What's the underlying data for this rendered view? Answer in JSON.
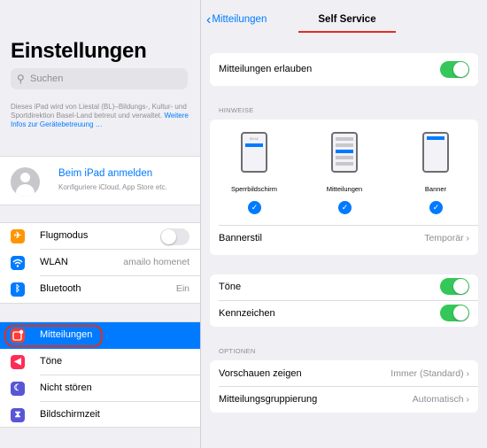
{
  "left": {
    "title": "Einstellungen",
    "search_placeholder": "Suchen",
    "notice_text": "Dieses iPad wird von Liestal (BL)–Bildungs-, Kultur- und Sportdirektion Basel-Land betreut und verwaltet.",
    "notice_link": "Weitere Infos zur Gerätebetreuung …",
    "account": {
      "name": "Beim iPad anmelden",
      "subtitle": "Konfiguriere iCloud, App Store etc."
    },
    "connectivity": [
      {
        "label": "Flugmodus",
        "value": "",
        "icon": "airplane-icon",
        "color": "#ff9500"
      },
      {
        "label": "WLAN",
        "value": "amailo homenet",
        "icon": "wifi-icon",
        "color": "#007aff"
      },
      {
        "label": "Bluetooth",
        "value": "Ein",
        "icon": "bluetooth-icon",
        "color": "#007aff"
      }
    ],
    "notifications_group": [
      {
        "label": "Mitteilungen",
        "icon": "notifications-icon",
        "color": "#ff3b30",
        "selected": true
      },
      {
        "label": "Töne",
        "icon": "sounds-icon",
        "color": "#ff2d55"
      },
      {
        "label": "Nicht stören",
        "icon": "moon-icon",
        "color": "#5856d6"
      },
      {
        "label": "Bildschirmzeit",
        "icon": "hourglass-icon",
        "color": "#5856d6"
      }
    ]
  },
  "right": {
    "back_label": "Mitteilungen",
    "title": "Self Service",
    "allow_notifications_label": "Mitteilungen erlauben",
    "hints_header": "HINWEISE",
    "alert_styles": [
      {
        "label": "Sperrbildschirm",
        "time": "09:41"
      },
      {
        "label": "Mitteilungen"
      },
      {
        "label": "Banner"
      }
    ],
    "banner_style_label": "Bannerstil",
    "banner_style_value": "Temporär",
    "sounds_label": "Töne",
    "badges_label": "Kennzeichen",
    "options_header": "OPTIONEN",
    "show_previews_label": "Vorschauen zeigen",
    "show_previews_value": "Immer (Standard)",
    "grouping_label": "Mitteilungsgruppierung",
    "grouping_value": "Automatisch"
  },
  "colors": {
    "accent": "#007aff",
    "toggle_on": "#34c759",
    "highlight": "#e0301e"
  }
}
